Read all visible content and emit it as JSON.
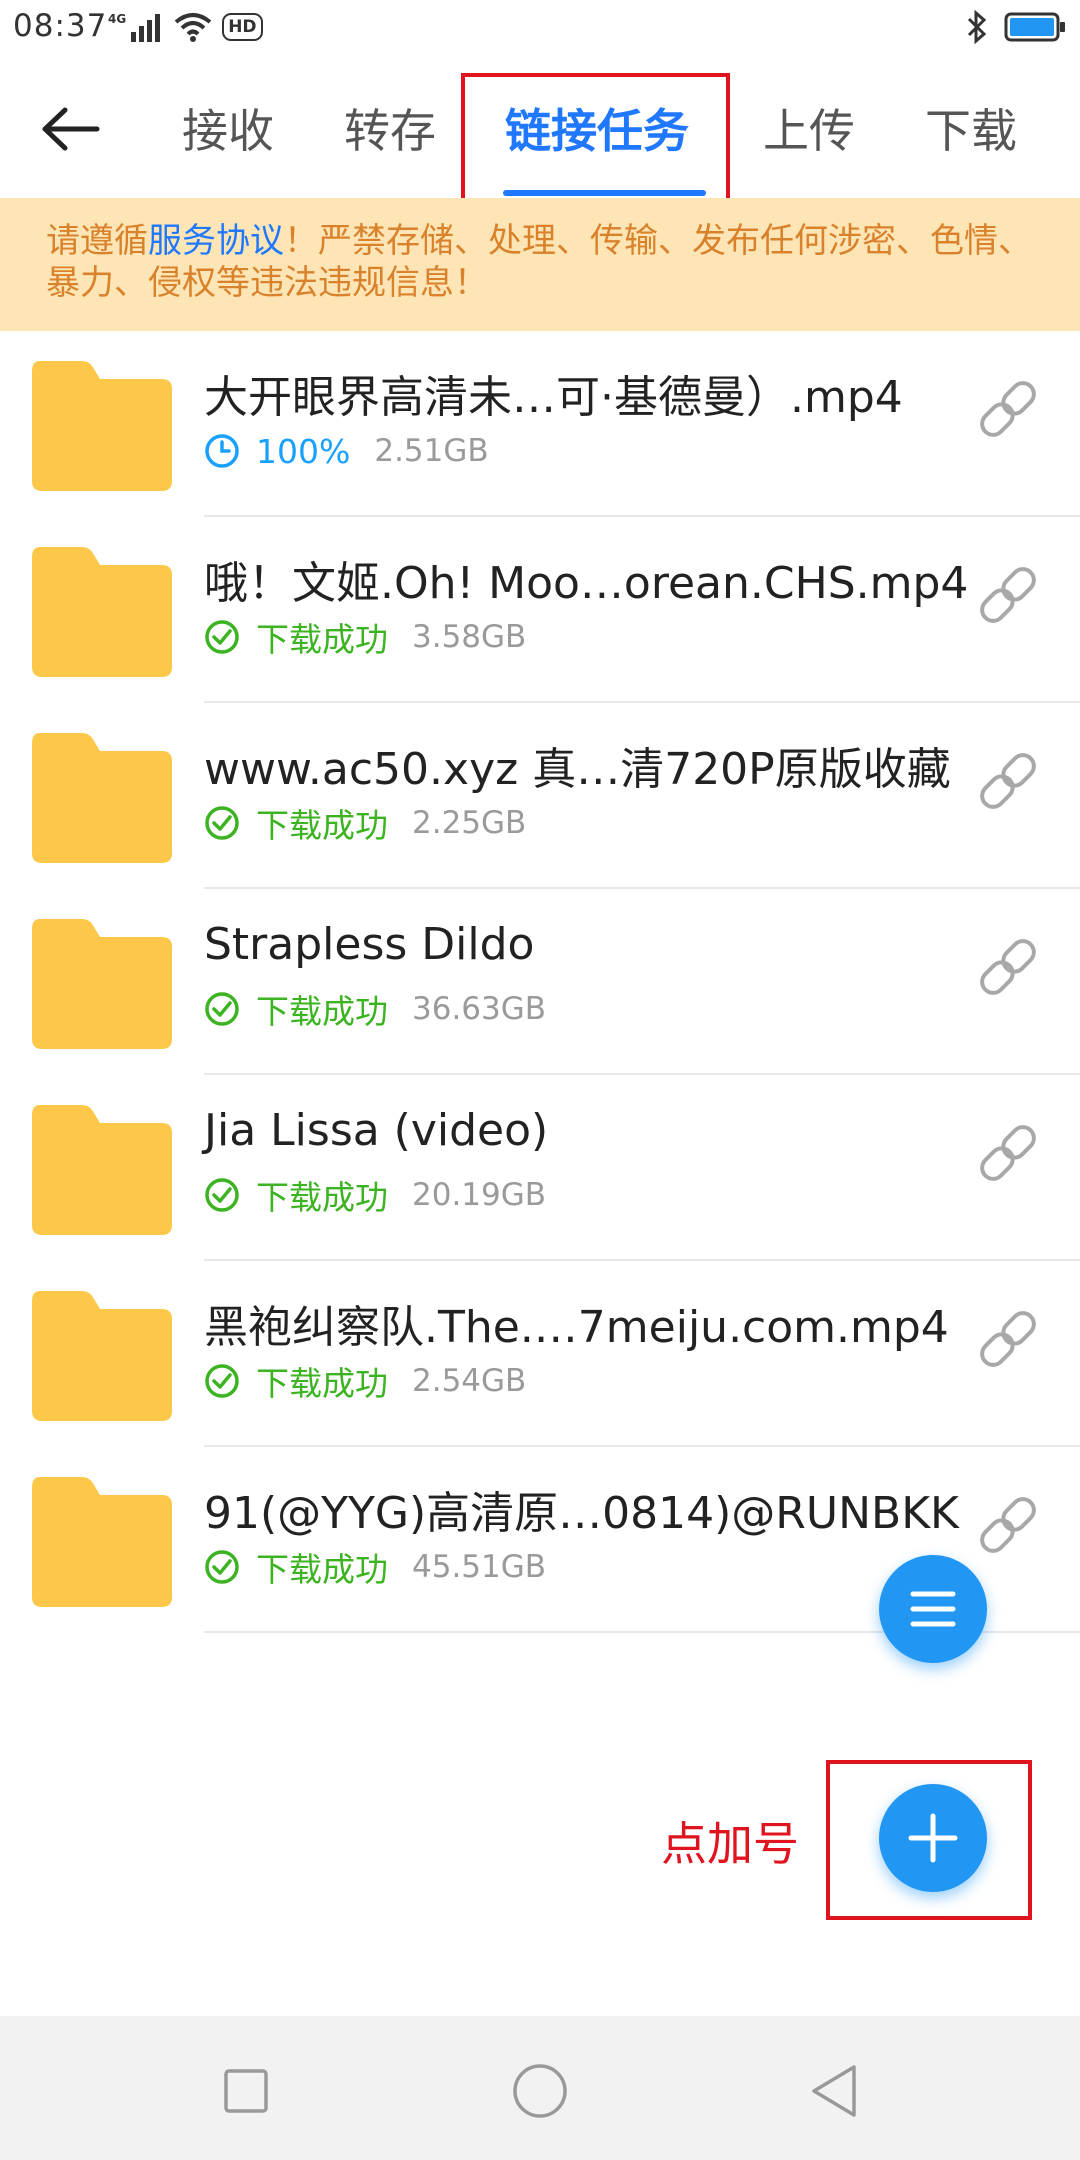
{
  "status_bar": {
    "time": "08:37",
    "network_label": "4G",
    "hd_label": "HD",
    "icons": [
      "signal-icon",
      "wifi-icon",
      "bluetooth-icon",
      "battery-icon"
    ]
  },
  "header": {
    "tabs": [
      {
        "label": "接收",
        "active": false
      },
      {
        "label": "转存",
        "active": false
      },
      {
        "label": "链接任务",
        "active": true
      },
      {
        "label": "上传",
        "active": false
      },
      {
        "label": "下载",
        "active": false
      }
    ]
  },
  "notice": {
    "prefix": "请遵循",
    "link": "服务协议",
    "suffix": "！严禁存储、处理、传输、发布任何涉密、色情、暴力、侵权等违法违规信息！"
  },
  "files": [
    {
      "name": "大开眼界高清未…可·基德曼）.mp4",
      "status": "100%",
      "status_type": "progress",
      "size": "2.51GB"
    },
    {
      "name": "哦！文姬.Oh! Moo…orean.CHS.mp4",
      "status": "下载成功",
      "status_type": "ok",
      "size": "3.58GB"
    },
    {
      "name": "www.ac50.xyz 真…清720P原版收藏",
      "status": "下载成功",
      "status_type": "ok",
      "size": "2.25GB"
    },
    {
      "name": "Strapless Dildo",
      "status": "下载成功",
      "status_type": "ok",
      "size": "36.63GB"
    },
    {
      "name": "Jia Lissa (video)",
      "status": "下载成功",
      "status_type": "ok",
      "size": "20.19GB"
    },
    {
      "name": "黑袍纠察队.The.…7meiju.com.mp4",
      "status": "下载成功",
      "status_type": "ok",
      "size": "2.54GB"
    },
    {
      "name": "91(@YYG)高清原…0814)@RUNBKK",
      "status": "下载成功",
      "status_type": "ok",
      "size": "45.51GB"
    }
  ],
  "annotation": {
    "hint": "点加号"
  },
  "colors": {
    "accent": "#1f78ff",
    "success": "#3cb321",
    "folder": "#fdc84a",
    "notice_bg": "#fde5b5",
    "notice_text": "#d9822b",
    "annotation": "#e0141e"
  }
}
